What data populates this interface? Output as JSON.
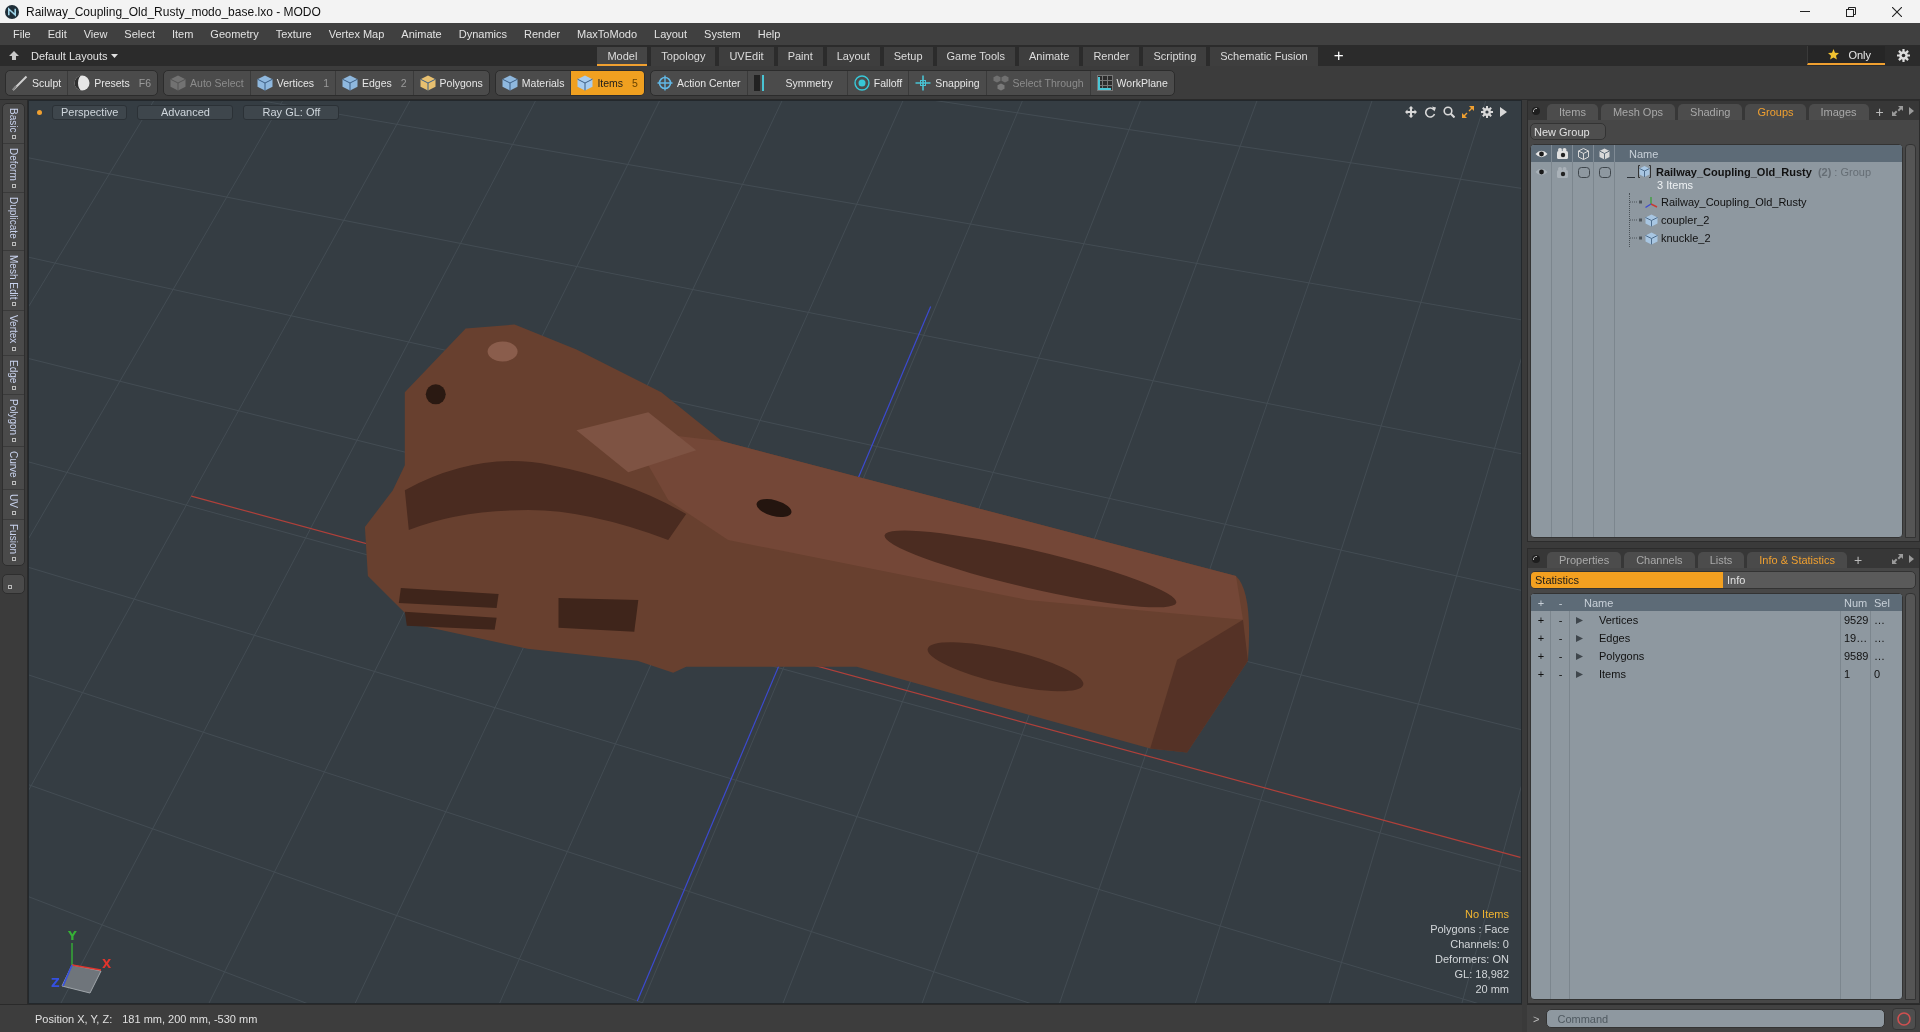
{
  "window": {
    "title": "Railway_Coupling_Old_Rusty_modo_base.lxo - MODO"
  },
  "menu_bar": [
    "File",
    "Edit",
    "View",
    "Select",
    "Item",
    "Geometry",
    "Texture",
    "Vertex Map",
    "Animate",
    "Dynamics",
    "Render",
    "MaxToModo",
    "Layout",
    "System",
    "Help"
  ],
  "layout_bar": {
    "layouts": "Default Layouts",
    "tabs": [
      {
        "label": "Model",
        "selected": true
      },
      {
        "label": "Topology",
        "selected": false
      },
      {
        "label": "UVEdit",
        "selected": false
      },
      {
        "label": "Paint",
        "selected": false
      },
      {
        "label": "Layout",
        "selected": false
      },
      {
        "label": "Setup",
        "selected": false
      },
      {
        "label": "Game Tools",
        "selected": false
      },
      {
        "label": "Animate",
        "selected": false
      },
      {
        "label": "Render",
        "selected": false
      },
      {
        "label": "Scripting",
        "selected": false
      },
      {
        "label": "Schematic Fusion",
        "selected": false
      }
    ],
    "add": "+",
    "filter": {
      "label": "Only",
      "on": true
    }
  },
  "toolbar": {
    "groups": [
      {
        "items": [
          {
            "label": "Sculpt",
            "selected": false,
            "disabled": false
          },
          {
            "label": "Presets",
            "shortcut": "F6",
            "selected": false,
            "disabled": false
          }
        ]
      },
      {
        "items": [
          {
            "label": "Auto Select",
            "selected": false,
            "disabled": true
          },
          {
            "label": "Vertices",
            "shortcut": "1",
            "selected": false,
            "disabled": false
          },
          {
            "label": "Edges",
            "shortcut": "2",
            "selected": false,
            "disabled": false
          },
          {
            "label": "Polygons",
            "selected": false,
            "disabled": false
          }
        ]
      },
      {
        "items": [
          {
            "label": "Materials",
            "selected": false,
            "disabled": false
          },
          {
            "label": "Items",
            "shortcut": "5",
            "selected": true,
            "disabled": false
          }
        ]
      },
      {
        "items": [
          {
            "label": "Action Center",
            "selected": false,
            "disabled": false
          },
          {
            "label": "Symmetry",
            "selected": false,
            "disabled": false
          },
          {
            "label": "Falloff",
            "selected": false,
            "disabled": false
          },
          {
            "label": "Snapping",
            "selected": false,
            "disabled": false
          },
          {
            "label": "Select Through",
            "selected": false,
            "disabled": true
          },
          {
            "label": "WorkPlane",
            "selected": false,
            "disabled": false
          }
        ]
      }
    ]
  },
  "side_tabs": [
    "Basic",
    "Deform",
    "Duplicate",
    "Mesh Edit",
    "Vertex",
    "Edge",
    "Polygon",
    "Curve",
    "UV",
    "Fusion"
  ],
  "viewport": {
    "header_buttons": [
      "Perspective",
      "Advanced",
      "Ray GL: Off"
    ],
    "info": [
      {
        "text": "No Items",
        "kind": "status"
      },
      {
        "text": "Polygons : Face",
        "kind": "stat"
      },
      {
        "text": "Channels: 0",
        "kind": "stat"
      },
      {
        "text": "Deformers: ON",
        "kind": "stat"
      },
      {
        "text": "GL: 18,982",
        "kind": "stat"
      },
      {
        "text": "20 mm",
        "kind": "stat"
      }
    ],
    "axis_labels": [
      {
        "text": "Y",
        "color": "#36b036"
      },
      {
        "text": "X",
        "color": "#e0352d"
      },
      {
        "text": "Z",
        "color": "#3550e0"
      }
    ]
  },
  "groups_panel": {
    "tabs": [
      {
        "label": "Items",
        "selected": false
      },
      {
        "label": "Mesh Ops",
        "selected": false
      },
      {
        "label": "Shading",
        "selected": false
      },
      {
        "label": "Groups",
        "selected": true
      },
      {
        "label": "Images",
        "selected": false
      }
    ],
    "add": "+",
    "new_group": "New Group",
    "name_column": "Name",
    "groups": [
      {
        "name": "Railway_Coupling_Old_Rusty",
        "count": "(2)",
        "type": ": Group",
        "summary": "3 Items",
        "expanded": true,
        "children": [
          {
            "name": "Railway_Coupling_Old_Rusty",
            "kind": "locator"
          },
          {
            "name": "coupler_2",
            "kind": "mesh"
          },
          {
            "name": "knuckle_2",
            "kind": "mesh"
          }
        ]
      }
    ]
  },
  "stats_panel": {
    "tabs": [
      {
        "label": "Properties",
        "selected": false
      },
      {
        "label": "Channels",
        "selected": false
      },
      {
        "label": "Lists",
        "selected": false
      },
      {
        "label": "Info & Statistics",
        "selected": true
      }
    ],
    "add": "+",
    "modes": [
      {
        "label": "Statistics",
        "selected": true
      },
      {
        "label": "Info",
        "selected": false
      }
    ],
    "columns": {
      "add": "+",
      "remove": "-",
      "name": "Name",
      "num": "Num",
      "sel": "Sel"
    },
    "rows": [
      {
        "add": "+",
        "remove": "-",
        "name": "Vertices",
        "num": "9529",
        "sel": "…",
        "expanded": false
      },
      {
        "add": "+",
        "remove": "-",
        "name": "Edges",
        "num": "19…",
        "sel": "…",
        "expanded": false
      },
      {
        "add": "+",
        "remove": "-",
        "name": "Polygons",
        "num": "9589",
        "sel": "…",
        "expanded": false
      },
      {
        "add": "+",
        "remove": "-",
        "name": "Items",
        "num": "1",
        "sel": "0",
        "expanded": false
      }
    ]
  },
  "status_bar": {
    "label": "Position X, Y, Z:",
    "value": "181 mm, 200 mm, -530 mm"
  },
  "command_bar": {
    "prompt": ">",
    "placeholder": "Command"
  }
}
